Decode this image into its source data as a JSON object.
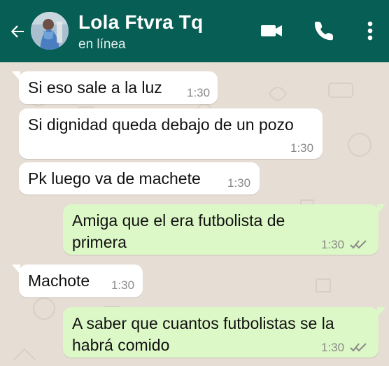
{
  "header": {
    "contact_name": "Lola Ftvra Tq",
    "status": "en línea",
    "icons": [
      "back-arrow-icon",
      "video-call-icon",
      "phone-icon",
      "more-vert-icon"
    ]
  },
  "messages": [
    {
      "direction": "incoming",
      "text": "Si eso sale a la luz",
      "time": "1:30"
    },
    {
      "direction": "incoming",
      "text": "Si dignidad queda debajo de un pozo",
      "time": "1:30"
    },
    {
      "direction": "incoming",
      "text": "Pk luego va de machete",
      "time": "1:30"
    },
    {
      "direction": "outgoing",
      "lines": [
        "Amiga que el era futbolista de",
        "primera"
      ],
      "time": "1:30",
      "status": "read-double-check"
    },
    {
      "direction": "incoming",
      "text": "Machote",
      "time": "1:30"
    },
    {
      "direction": "outgoing",
      "lines": [
        "A saber que cuantos futbolistas se la",
        "habrá comido"
      ],
      "time": "1:30",
      "status": "read-double-check"
    }
  ],
  "colors": {
    "header_bg": "#075e54",
    "chat_bg": "#e6ddd4",
    "incoming_bubble": "#ffffff",
    "outgoing_bubble": "#dcf8c6"
  }
}
